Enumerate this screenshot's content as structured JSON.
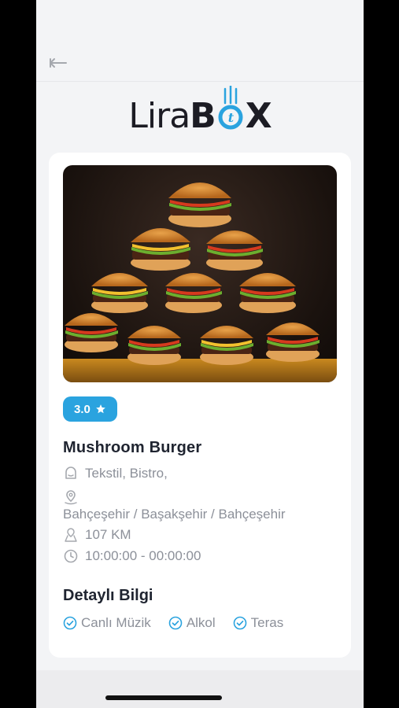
{
  "brand": {
    "logo_part1": "Lira",
    "logo_part2a": "B",
    "logo_part2b": "X",
    "logo_o_letter": "t",
    "accent": "#2aa3df"
  },
  "venue": {
    "rating": "3.0",
    "name": "Mushroom Burger",
    "categories": "Tekstil, Bistro,",
    "address": "Bahçeşehir / Başakşehir / Bahçeşehir",
    "distance": "107 KM",
    "hours": "10:00:00 - 00:00:00"
  },
  "details": {
    "title": "Detaylı Bilgi",
    "features": [
      "Canlı Müzik",
      "Alkol",
      "Teras"
    ]
  },
  "icons": {
    "back": "back-arrow-icon",
    "rating": "star-icon",
    "category": "category-icon",
    "location": "location-pin-icon",
    "distance": "distance-icon",
    "hours": "clock-icon",
    "feature": "check-circle-icon"
  }
}
